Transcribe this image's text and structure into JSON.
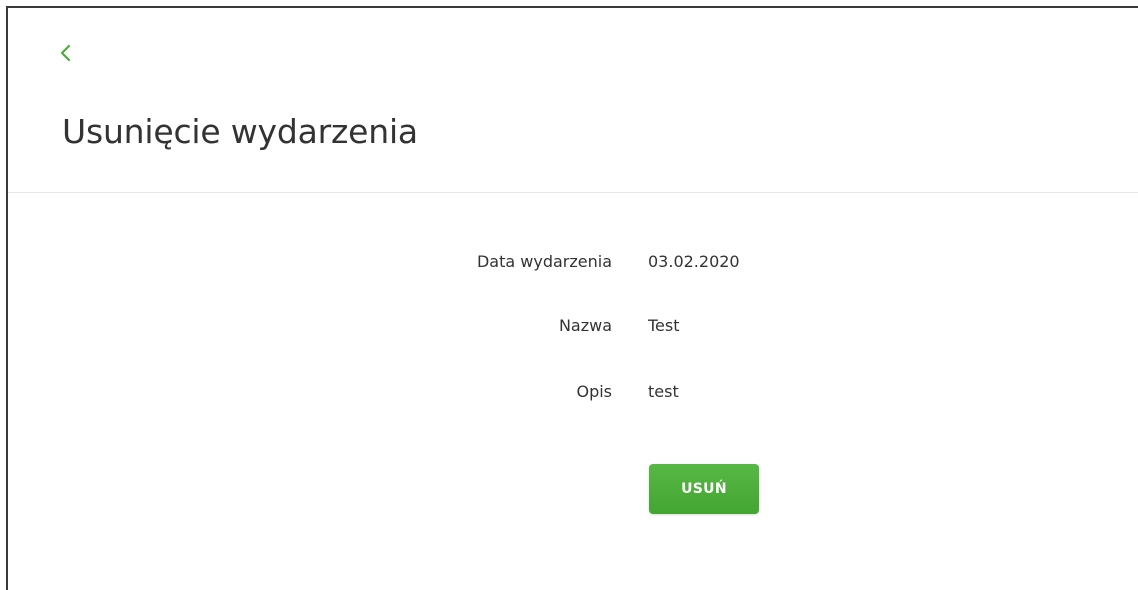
{
  "header": {
    "back_icon": "chevron-left-icon",
    "title": "Usunięcie wydarzenia"
  },
  "details": [
    {
      "label": "Data wydarzenia",
      "value": "03.02.2020"
    },
    {
      "label": "Nazwa",
      "value": "Test"
    },
    {
      "label": "Opis",
      "value": "test"
    }
  ],
  "actions": {
    "delete_label": "USUŃ"
  },
  "colors": {
    "accent": "#4cae3a",
    "text": "#333333",
    "divider": "#e6e6e6"
  }
}
